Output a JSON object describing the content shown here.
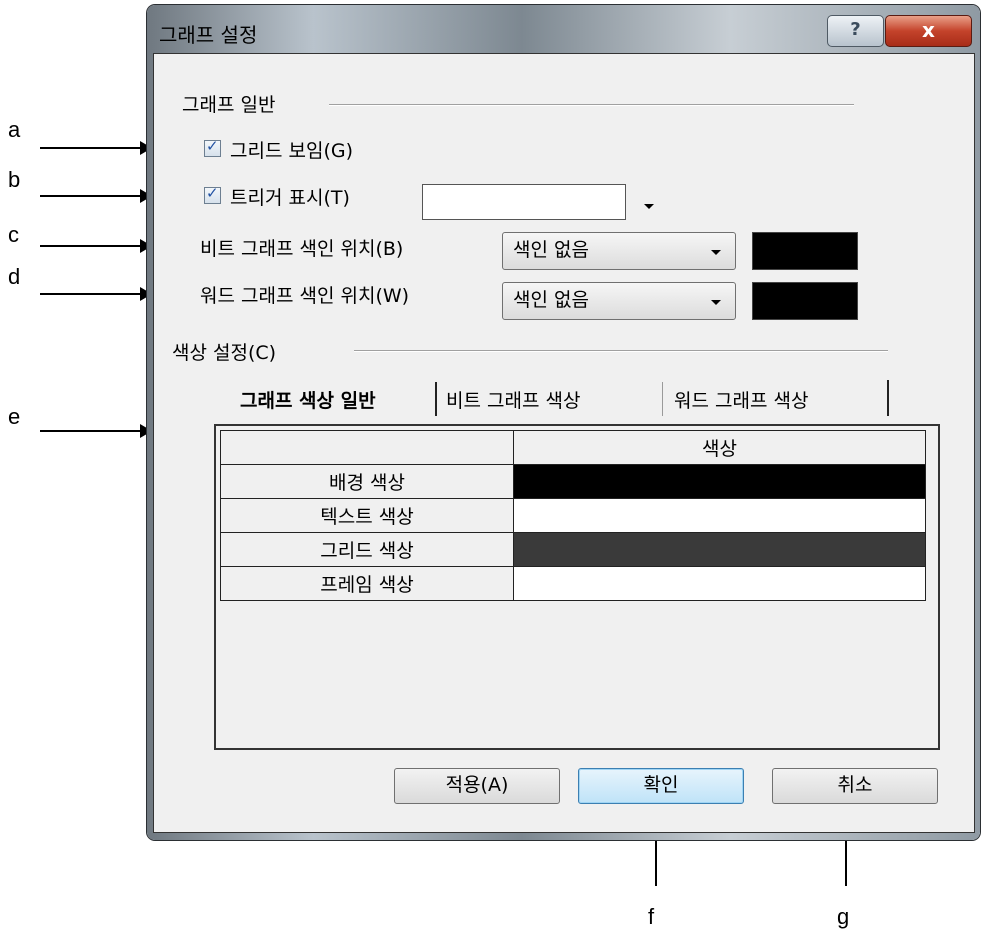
{
  "window": {
    "title": "그래프 설정",
    "help_label": "?",
    "close_label": "x"
  },
  "general": {
    "section_label": "그래프 일반",
    "grid_checkbox": {
      "label": "그리드 보임(G)",
      "checked": true
    },
    "trigger_checkbox": {
      "label": "트리거 표시(T)",
      "checked": true
    },
    "bit_index": {
      "label": "비트 그래프 색인 위치(B)",
      "value": "색인 없음",
      "color": "#000000"
    },
    "word_index": {
      "label": "워드 그래프 색인 위치(W)",
      "value": "색인 없음",
      "color": "#000000"
    }
  },
  "color_settings": {
    "section_label": "색상 설정(C)",
    "tabs": [
      "그래프 색상 일반",
      "비트 그래프 색상",
      "워드 그래프 색상"
    ],
    "active_tab": 0,
    "table": {
      "header_color_col": "색상",
      "rows": [
        {
          "name": "배경 색상",
          "color": "#000000"
        },
        {
          "name": "텍스트 색상",
          "color": "#ffffff"
        },
        {
          "name": "그리드 색상",
          "color": "#3a3a3a"
        },
        {
          "name": "프레임 색상",
          "color": "#ffffff"
        }
      ]
    }
  },
  "buttons": {
    "apply": "적용(A)",
    "ok": "확인",
    "cancel": "취소"
  },
  "callouts": {
    "a": "a",
    "b": "b",
    "c": "c",
    "d": "d",
    "e": "e",
    "f": "f",
    "g": "g"
  }
}
